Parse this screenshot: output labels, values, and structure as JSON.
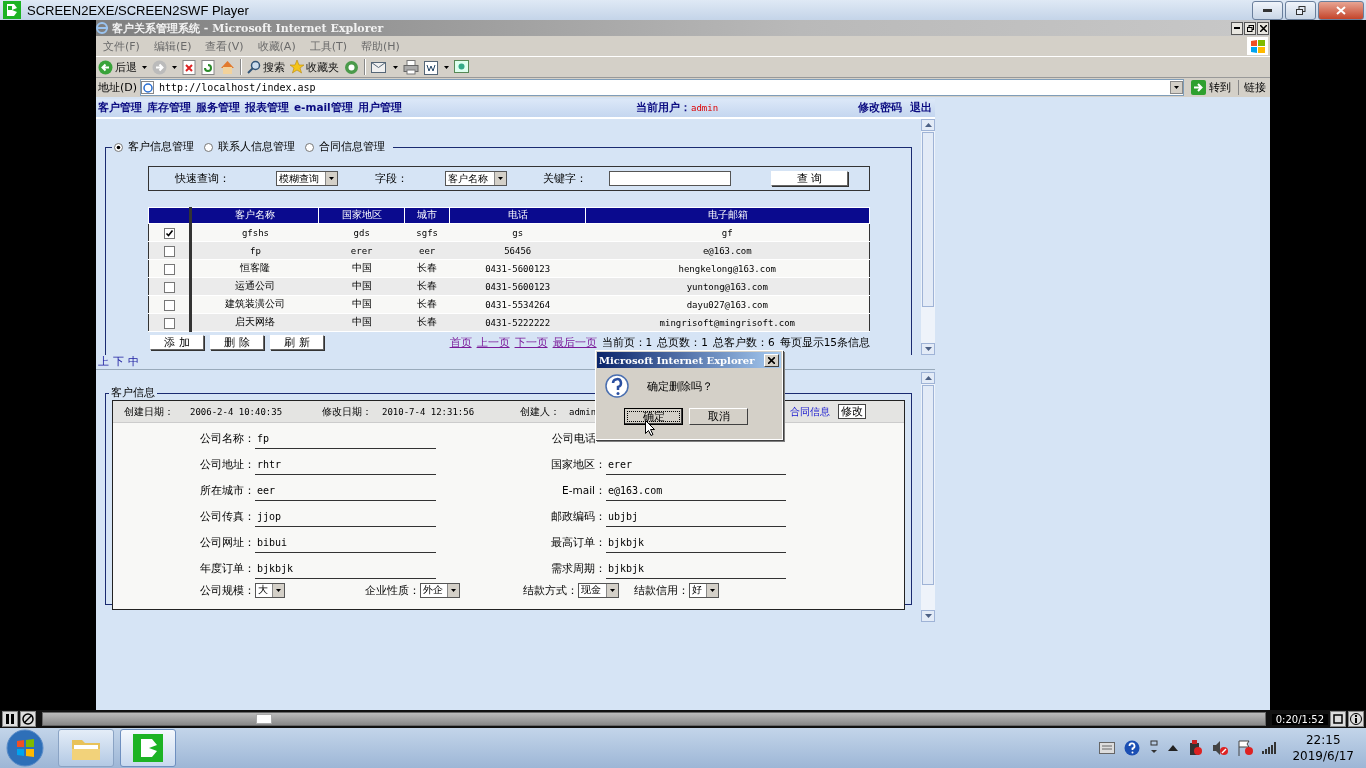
{
  "player": {
    "title": "SCREEN2EXE/SCREEN2SWF Player",
    "level": 0.18,
    "time": "0:20/1:52"
  },
  "browser": {
    "title": "客户关系管理系统 - Microsoft Internet Explorer",
    "menu": [
      "文件(F)",
      "编辑(E)",
      "查看(V)",
      "收藏(A)",
      "工具(T)",
      "帮助(H)"
    ],
    "back": "后退",
    "search": "搜索",
    "favorites": "收藏夹",
    "address_label": "地址(D)",
    "url": "http://localhost/index.asp",
    "go": "转到",
    "links": "链接"
  },
  "nav": {
    "links": [
      "客户管理",
      "库存管理",
      "服务管理",
      "报表管理",
      "e-mail管理",
      "用户管理"
    ],
    "user_label": "当前用户：",
    "user": "admin",
    "actions": [
      "修改密码",
      "退出"
    ]
  },
  "modes": [
    {
      "label": "客户信息管理",
      "selected": true
    },
    {
      "label": "联系人信息管理",
      "selected": false
    },
    {
      "label": "合同信息管理",
      "selected": false
    }
  ],
  "search": {
    "label": "快速查询：",
    "mode": "模糊查询",
    "field_label": "字段：",
    "field": "客户名称",
    "keyword_label": "关键字：",
    "button": "查 询"
  },
  "table": {
    "columns": [
      "客户名称",
      "国家地区",
      "城市",
      "电话",
      "电子邮箱"
    ],
    "rows": [
      {
        "checked": true,
        "cells": [
          "gfshs",
          "gds",
          "sgfs",
          "gs",
          "gf"
        ]
      },
      {
        "checked": false,
        "cells": [
          "fp",
          "erer",
          "eer",
          "56456",
          "e@163.com"
        ]
      },
      {
        "checked": false,
        "cells": [
          "恒客隆",
          "中国",
          "长春",
          "0431-5600123",
          "hengkelong@163.com"
        ]
      },
      {
        "checked": false,
        "cells": [
          "运通公司",
          "中国",
          "长春",
          "0431-5600123",
          "yuntong@163.com"
        ]
      },
      {
        "checked": false,
        "cells": [
          "建筑装潢公司",
          "中国",
          "长春",
          "0431-5534264",
          "dayu027@163.com"
        ]
      },
      {
        "checked": false,
        "cells": [
          "启天网络",
          "中国",
          "长春",
          "0431-5222222",
          "mingrisoft@mingrisoft.com"
        ]
      }
    ]
  },
  "table_buttons": [
    "添 加",
    "删 除",
    "刷 新"
  ],
  "pager": {
    "links": [
      "首页",
      "上一页",
      "下一页",
      "最后一页"
    ],
    "info": [
      "当前页：1",
      "总页数：1",
      "总客户数：6",
      "每页显示15条信息"
    ]
  },
  "frame_links": [
    "上",
    "下",
    "中"
  ],
  "detail": {
    "legend": "客户信息",
    "meta": [
      {
        "label": "创建日期：",
        "value": "2006-2-4 10:40:35"
      },
      {
        "label": "修改日期：",
        "value": "2010-7-4 12:31:56"
      },
      {
        "label": "创建人：",
        "value": "admin"
      }
    ],
    "contract_link": "合同信息",
    "edit_button": "修改",
    "fields": [
      {
        "label": "公司名称：",
        "value": "fp"
      },
      {
        "label": "公司电话"
      },
      {
        "label": "公司地址：",
        "value": "rhtr"
      },
      {
        "label": "国家地区：",
        "value": "erer"
      },
      {
        "label": "所在城市：",
        "value": "eer"
      },
      {
        "label": "E-mail：",
        "value": "e@163.com"
      },
      {
        "label": "公司传真：",
        "value": "jjop"
      },
      {
        "label": "邮政编码：",
        "value": "ubjbj"
      },
      {
        "label": "公司网址：",
        "value": "bibui"
      },
      {
        "label": "最高订单：",
        "value": "bjkbjk"
      },
      {
        "label": "年度订单：",
        "value": "bjkbjk"
      },
      {
        "label": "需求周期：",
        "value": "bjkbjk"
      }
    ],
    "selects": [
      {
        "label": "公司规模：",
        "value": "大"
      },
      {
        "label": "企业性质：",
        "value": "外企"
      },
      {
        "label": "结款方式：",
        "value": "现金"
      },
      {
        "label": "结款信用：",
        "value": "好"
      }
    ]
  },
  "dialog": {
    "title": "Microsoft Internet Explorer",
    "message": "确定删除吗？",
    "buttons": [
      "确定",
      "取消"
    ]
  },
  "taskbar": {
    "time": "22:15",
    "date": "2019/6/17"
  }
}
